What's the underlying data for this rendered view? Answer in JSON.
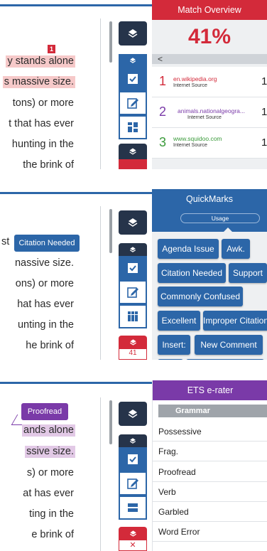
{
  "panel1": {
    "sidebar_title": "Match Overview",
    "percent": "41%",
    "back_label": "<",
    "sources": [
      {
        "num": "1",
        "domain": "en.wikipedia.org",
        "type": "Internet Source",
        "pct": "1",
        "color": "#d32a3a"
      },
      {
        "num": "2",
        "domain": "animals.nationalgeogra...",
        "type": "Internet Source",
        "pct": "1",
        "color": "#7a3aa8"
      },
      {
        "num": "3",
        "domain": "www.squidoo.com",
        "type": "Internet Source",
        "pct": "1",
        "color": "#3a9a3a"
      }
    ],
    "lines": [
      "y stands alone",
      "s massive size.",
      "tons) or more",
      "t that has ever",
      "hunting in the",
      "the brink of"
    ],
    "marker": "1"
  },
  "panel2": {
    "sidebar_title": "QuickMarks",
    "subtab": "Usage",
    "tooltip": "Citation Needed",
    "lines": [
      "st",
      "nassive size.",
      "ons) or more",
      "hat has ever",
      "unting in the",
      "he brink of"
    ],
    "buttons": [
      "Agenda Issue",
      "Awk.",
      "Citation Needed",
      "Support",
      "Commonly Confused",
      "Excellent",
      "Improper Citation",
      "Insert:",
      "New Comment"
    ],
    "badge": "41"
  },
  "panel3": {
    "sidebar_title": "ETS e-rater",
    "category": "Grammar",
    "tooltip": "Proofread",
    "lines": [
      "ands alone",
      "ssive size.",
      "s) or more",
      "at has ever",
      "ting in the",
      "e brink of"
    ],
    "items": [
      "Possessive",
      "Frag.",
      "Proofread",
      "Verb",
      "Garbled",
      "Word Error"
    ]
  },
  "colors": {
    "accent": "#2c66a8",
    "red": "#d32a3a",
    "purple": "#7a3aa8",
    "dark": "#26344a"
  }
}
